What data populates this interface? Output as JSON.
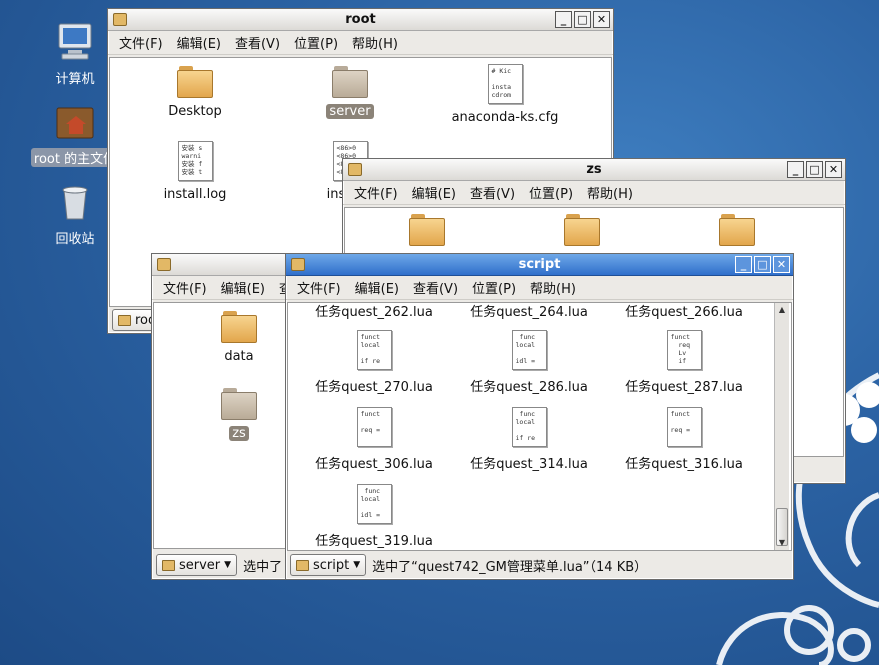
{
  "desktop": {
    "icons": [
      {
        "label": "计算机"
      },
      {
        "label": "root 的主文件"
      },
      {
        "label": "回收站"
      }
    ]
  },
  "root_window": {
    "title": "root",
    "menu": [
      "文件(F)",
      "编辑(E)",
      "查看(V)",
      "位置(P)",
      "帮助(H)"
    ],
    "items": [
      {
        "label": "Desktop"
      },
      {
        "label": "server"
      },
      {
        "label": "anaconda-ks.cfg",
        "preview": "# Kic\n\ninsta\ncdrom"
      },
      {
        "label": "install.log",
        "preview": "安装 s\nwarni\n安装 f\n安装 t"
      },
      {
        "label": "install.l",
        "preview": "<86>0\n<86>0\n<8\n<8"
      }
    ],
    "location": "roo"
  },
  "zs_window": {
    "title": "zs",
    "menu": [
      "文件(F)",
      "编辑(E)",
      "查看(V)",
      "位置(P)",
      "帮助(H)"
    ]
  },
  "server_window": {
    "menu_visible": [
      "文件(F)",
      "编辑(E)",
      "查"
    ],
    "items": [
      {
        "label": "data"
      },
      {
        "label": "zs"
      }
    ],
    "location": "server",
    "status": "选中了"
  },
  "script_window": {
    "title": "script",
    "menu": [
      "文件(F)",
      "编辑(E)",
      "查看(V)",
      "位置(P)",
      "帮助(H)"
    ],
    "files": [
      {
        "label": "任务quest_262.lua",
        "preview": ""
      },
      {
        "label": "任务quest_264.lua",
        "preview": ""
      },
      {
        "label": "任务quest_266.lua",
        "preview": ""
      },
      {
        "label": "任务quest_270.lua",
        "preview": "funct\nlocal\n\nif re"
      },
      {
        "label": "任务quest_286.lua",
        "preview": " func\nlocal\n\nidl ="
      },
      {
        "label": "任务quest_287.lua",
        "preview": "funct\n  req\n  Lv\n  if"
      },
      {
        "label": "任务quest_306.lua",
        "preview": "funct\n\nreq ="
      },
      {
        "label": "任务quest_314.lua",
        "preview": " func\nlocal\n\nif re"
      },
      {
        "label": "任务quest_316.lua",
        "preview": "funct\n\nreq ="
      },
      {
        "label": "任务quest_319.lua",
        "preview": " func\nlocal\n\nidl ="
      }
    ],
    "location": "script",
    "status": "选中了“quest742_GM管理菜单.lua”（14 KB）"
  },
  "colors": {
    "active_title": "#2f6fcb",
    "desktop": "#2b62a3"
  }
}
